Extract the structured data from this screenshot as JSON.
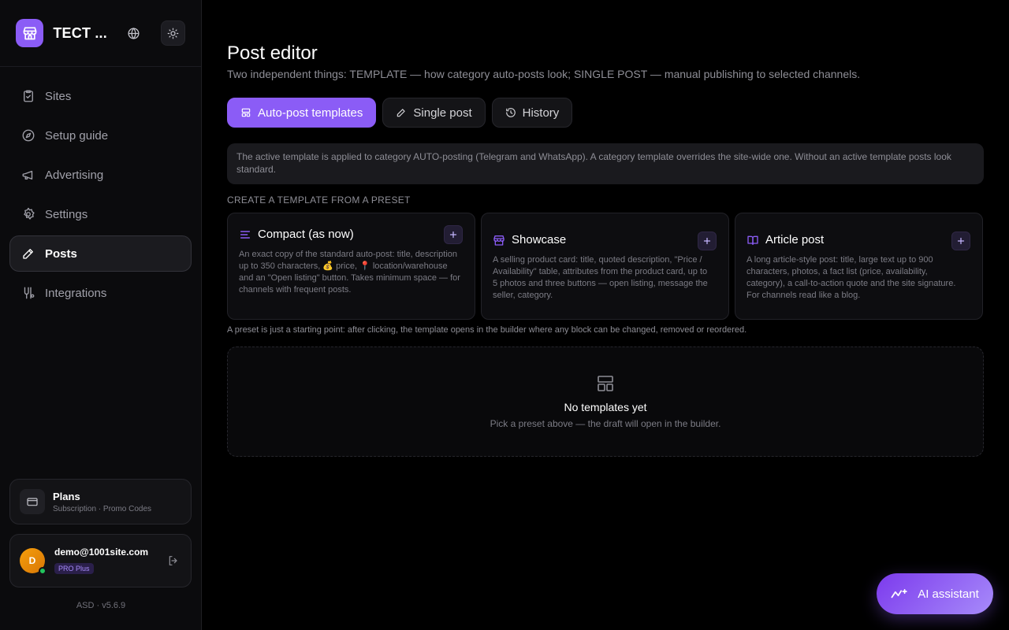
{
  "sidebar": {
    "brand_title": "TECT ...",
    "nav": [
      {
        "label": "Sites",
        "icon": "clipboard-check-icon"
      },
      {
        "label": "Setup guide",
        "icon": "compass-icon"
      },
      {
        "label": "Advertising",
        "icon": "megaphone-icon"
      },
      {
        "label": "Settings",
        "icon": "gear-icon"
      },
      {
        "label": "Posts",
        "icon": "pen-icon",
        "active": true
      },
      {
        "label": "Integrations",
        "icon": "integrations-icon"
      }
    ],
    "plans": {
      "title": "Plans",
      "subtitle": "Subscription · Promo Codes"
    },
    "user": {
      "initial": "D",
      "email": "demo@1001site.com",
      "badge": "PRO Plus"
    },
    "version": "ASD · v5.6.9"
  },
  "main": {
    "title": "Post editor",
    "subtitle": "Two independent things: TEMPLATE — how category auto-posts look; SINGLE POST — manual publishing to selected channels.",
    "tabs": [
      {
        "label": "Auto-post templates",
        "active": true
      },
      {
        "label": "Single post"
      },
      {
        "label": "History"
      }
    ],
    "info": "The active template is applied to category AUTO-posting (Telegram and WhatsApp). A category template overrides the site-wide one. Without an active template posts look standard.",
    "section_label": "CREATE A TEMPLATE FROM A PRESET",
    "presets": [
      {
        "title": "Compact (as now)",
        "icon": "lines-icon",
        "desc": "An exact copy of the standard auto-post: title, description up to 350 characters, 💰 price, 📍 location/warehouse and an \"Open listing\" button. Takes minimum space — for channels with frequent posts."
      },
      {
        "title": "Showcase",
        "icon": "store-icon",
        "desc": "A selling product card: title, quoted description, \"Price / Availability\" table, attributes from the product card, up to 5 photos and three buttons — open listing, message the seller, category."
      },
      {
        "title": "Article post",
        "icon": "book-icon",
        "desc": "A long article-style post: title, large text up to 900 characters, photos, a fact list (price, availability, category), a call-to-action quote and the site signature. For channels read like a blog."
      }
    ],
    "hint": "A preset is just a starting point: after clicking, the template opens in the builder where any block can be changed, removed or reordered.",
    "empty": {
      "title": "No templates yet",
      "subtitle": "Pick a preset above — the draft will open in the builder."
    }
  },
  "ai_button": {
    "label": "AI assistant"
  },
  "colors": {
    "accent": "#8b5cf6",
    "background": "#000000",
    "sidebar": "#0b0b0d"
  }
}
